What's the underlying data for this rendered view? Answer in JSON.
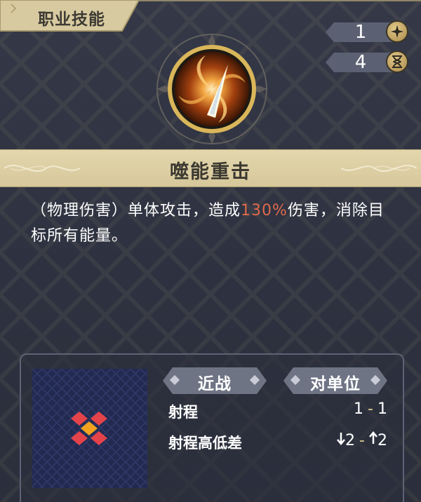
{
  "title": "职业技能",
  "counters": [
    {
      "value": "1",
      "icon": "sparkle-icon"
    },
    {
      "value": "4",
      "icon": "hourglass-icon"
    }
  ],
  "skill": {
    "name": "噬能重击",
    "description_before": "（物理伤害）单体攻击，造成",
    "description_highlight": "130%",
    "description_after": "伤害，消除目标所有能量。"
  },
  "range": {
    "tags": [
      "近战",
      "对单位"
    ],
    "range_label": "射程",
    "range_min": "1",
    "range_max": "1",
    "height_label": "射程高低差",
    "height_down": "2",
    "height_up": "2"
  },
  "colors": {
    "highlight": "#e06a4c",
    "banner": "#ddd0a6",
    "panel_bg": "#2f3341",
    "target_tile": "#f2a21e",
    "range_tile": "#e5434a"
  }
}
